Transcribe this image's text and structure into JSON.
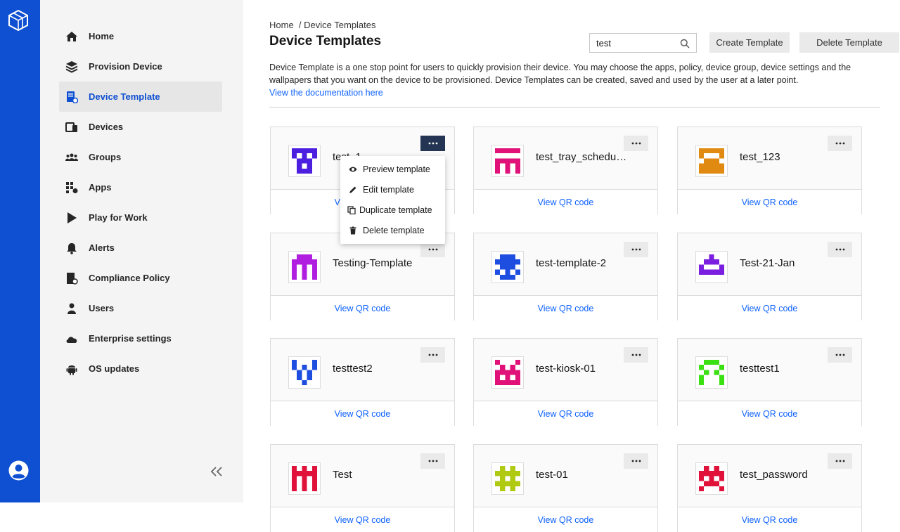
{
  "colors": {
    "rail": "#0f4fd1",
    "accent": "#0f62fe",
    "active_text": "#0f4fd1",
    "more_open": "#233553"
  },
  "sidebar": {
    "items": [
      {
        "label": "Home",
        "icon": "home-icon"
      },
      {
        "label": "Provision Device",
        "icon": "provision-icon"
      },
      {
        "label": "Device Template",
        "icon": "device-template-icon",
        "active": true
      },
      {
        "label": "Devices",
        "icon": "devices-icon"
      },
      {
        "label": "Groups",
        "icon": "groups-icon"
      },
      {
        "label": "Apps",
        "icon": "apps-icon"
      },
      {
        "label": "Play for Work",
        "icon": "play-icon"
      },
      {
        "label": "Alerts",
        "icon": "bell-icon"
      },
      {
        "label": "Compliance Policy",
        "icon": "compliance-icon"
      },
      {
        "label": "Users",
        "icon": "user-icon"
      },
      {
        "label": "Enterprise settings",
        "icon": "cloud-icon"
      },
      {
        "label": "OS updates",
        "icon": "android-icon"
      }
    ]
  },
  "breadcrumb": {
    "home": "Home",
    "current": "/ Device Templates"
  },
  "page": {
    "title": "Device Templates",
    "description": "Device Template is a one stop point for users to quickly provision their device. You may choose the apps, policy, device group, device settings and the wallpapers that you want on the device to be provisioned. Device Templates can be created, saved and used by the user at a later point.",
    "doc_link": "View the documentation here"
  },
  "search": {
    "value": "test",
    "placeholder": "Search"
  },
  "actions": {
    "create": "Create Template",
    "delete": "Delete Template"
  },
  "qr_label": "View QR code",
  "templates": [
    {
      "name": "test_1",
      "color": "#4c1ee0",
      "menu_open": true
    },
    {
      "name": "test_tray_scheduler",
      "color": "#e0127a"
    },
    {
      "name": "test_123",
      "color": "#e08a12"
    },
    {
      "name": "Testing-Template",
      "color": "#b01ee0"
    },
    {
      "name": "test-template-2",
      "color": "#1e4ee0"
    },
    {
      "name": "Test-21-Jan",
      "color": "#7a1ee0"
    },
    {
      "name": "testtest2",
      "color": "#1e4ee0"
    },
    {
      "name": "test-kiosk-01",
      "color": "#e0127a"
    },
    {
      "name": "testtest1",
      "color": "#3ae012"
    },
    {
      "name": "Test",
      "color": "#e0123a"
    },
    {
      "name": "test-01",
      "color": "#b0c912"
    },
    {
      "name": "test_password",
      "color": "#e0123a"
    }
  ],
  "context_menu": [
    {
      "label": "Preview template",
      "icon": "eye-icon"
    },
    {
      "label": "Edit template",
      "icon": "pencil-icon"
    },
    {
      "label": "Duplicate template",
      "icon": "copy-icon"
    },
    {
      "label": "Delete template",
      "icon": "trash-icon"
    }
  ]
}
